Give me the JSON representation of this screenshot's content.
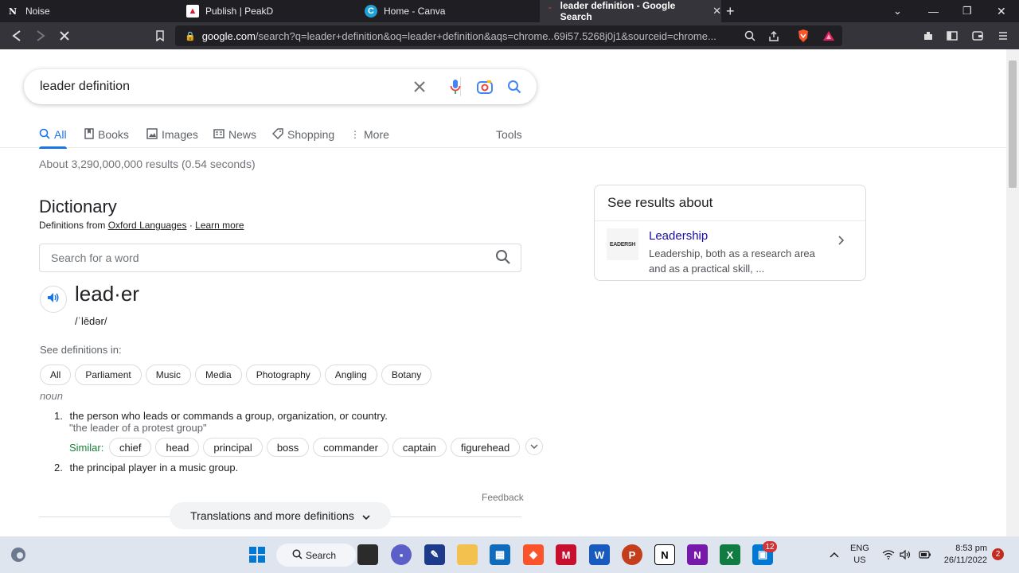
{
  "browser": {
    "tabs": [
      {
        "title": "Noise",
        "icon": "notion-icon",
        "active": false
      },
      {
        "title": "Publish | PeakD",
        "icon": "peakd-icon",
        "active": false
      },
      {
        "title": "Home - Canva",
        "icon": "canva-icon",
        "active": false
      },
      {
        "title": "leader definition - Google Search",
        "icon": "google-icon",
        "active": true
      }
    ],
    "url_host": "google.com",
    "url_path": "/search?q=leader+definition&oq=leader+definition&aqs=chrome..69i57.5268j0j1&sourceid=chrome..."
  },
  "search": {
    "query": "leader definition",
    "tabs": [
      "All",
      "Books",
      "Images",
      "News",
      "Shopping",
      "More"
    ],
    "tools_label": "Tools",
    "stats": "About 3,290,000,000 results (0.54 seconds)"
  },
  "dictionary": {
    "title": "Dictionary",
    "from_prefix": "Definitions from",
    "source": "Oxford Languages",
    "learn_more": "Learn more",
    "search_placeholder": "Search for a word",
    "headword": "lead·er",
    "phonetic": "/ˈlēdər/",
    "see_definitions": "See definitions in:",
    "categories": [
      "All",
      "Parliament",
      "Music",
      "Media",
      "Photography",
      "Angling",
      "Botany"
    ],
    "part_of_speech": "noun",
    "definitions": [
      {
        "num": "1.",
        "text": "the person who leads or commands a group, organization, or country.",
        "example": "\"the leader of a protest group\""
      },
      {
        "num": "2.",
        "text": "the principal player in a music group."
      }
    ],
    "similar_label": "Similar:",
    "similar": [
      "chief",
      "head",
      "principal",
      "boss",
      "commander",
      "captain",
      "figurehead"
    ],
    "feedback": "Feedback",
    "more_definitions": "Translations and more definitions"
  },
  "side_panel": {
    "title": "See results about",
    "thumb_text": "EADERSH",
    "link": "Leadership",
    "description": "Leadership, both as a research area and as a practical skill, ..."
  },
  "taskbar": {
    "search_label": "Search",
    "badge_count": "12",
    "lang": "ENG",
    "region": "US",
    "time": "8:53 pm",
    "date": "26/11/2022",
    "notifications": "2"
  },
  "colors": {
    "google_blue": "#1a73e8",
    "link": "#1a0dab",
    "similar_green": "#188038"
  }
}
